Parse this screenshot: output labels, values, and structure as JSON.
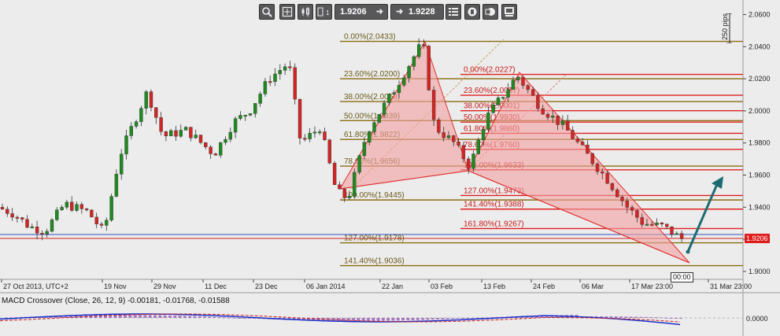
{
  "toolbar": {
    "icons": [
      "zoom-icon",
      "crosshair-icon",
      "candlestick-type-icon",
      "timeframe-icon",
      "indicators-list-icon",
      "objects-icon",
      "template-icon",
      "screenshot-icon"
    ],
    "timeframe_sub": "1",
    "bid": "1.9206",
    "ask": "1.9228"
  },
  "axis": {
    "pips_label": "250 pips",
    "y_ticks": [
      "2.0600",
      "2.0400",
      "2.0200",
      "2.0000",
      "1.9800",
      "1.9600",
      "1.9400",
      "1.9200",
      "1.9000"
    ],
    "current_price": "1.9206",
    "x_labels": [
      "27 Oct 2013, UTC+2",
      "19 Nov",
      "29 Nov",
      "11 Dec",
      "23 Dec",
      "06 Jan 2014",
      "22 Jan",
      "03 Feb",
      "13 Feb",
      "24 Feb",
      "06 Mar",
      "17 Mar 23:00",
      "31 Mar 23:00"
    ],
    "clock": "00:00"
  },
  "fib_left": {
    "labels": [
      "0.00%(2.0433)",
      "23.60%(2.0200)",
      "38.00%(2.0058)",
      "50.00%(1.9939)",
      "61.80%(1.9822)",
      "78.60%(1.9656)",
      "100.00%(1.9445)",
      "127.00%(1.9178)",
      "141.40%(1.9036)"
    ]
  },
  "fib_right": {
    "labels": [
      "0.00%(2.0227)",
      "23.60%(2.0097)",
      "38.00%(2.0001)",
      "50.00%(1.9930)",
      "61.80%(1.9860)",
      "78.60%(1.9760)",
      "100.00%(1.9633)",
      "127.00%(1.9473)",
      "141.40%(1.9388)",
      "161.80%(1.9267)"
    ]
  },
  "macd": {
    "label": "MACD Crossover (Close, 26, 12, 9)",
    "values": [
      "-0.00181",
      "-0.01768",
      "-0.01588"
    ],
    "zero_label": "0.0000"
  },
  "colors": {
    "background": "#ececec",
    "bull": "#1f8a1f",
    "bear": "#d42525",
    "fib_left": "#8a6d12",
    "fib_right": "#e02020",
    "pattern_fill": "#f4a0a0",
    "arrow": "#1d6b72"
  }
}
